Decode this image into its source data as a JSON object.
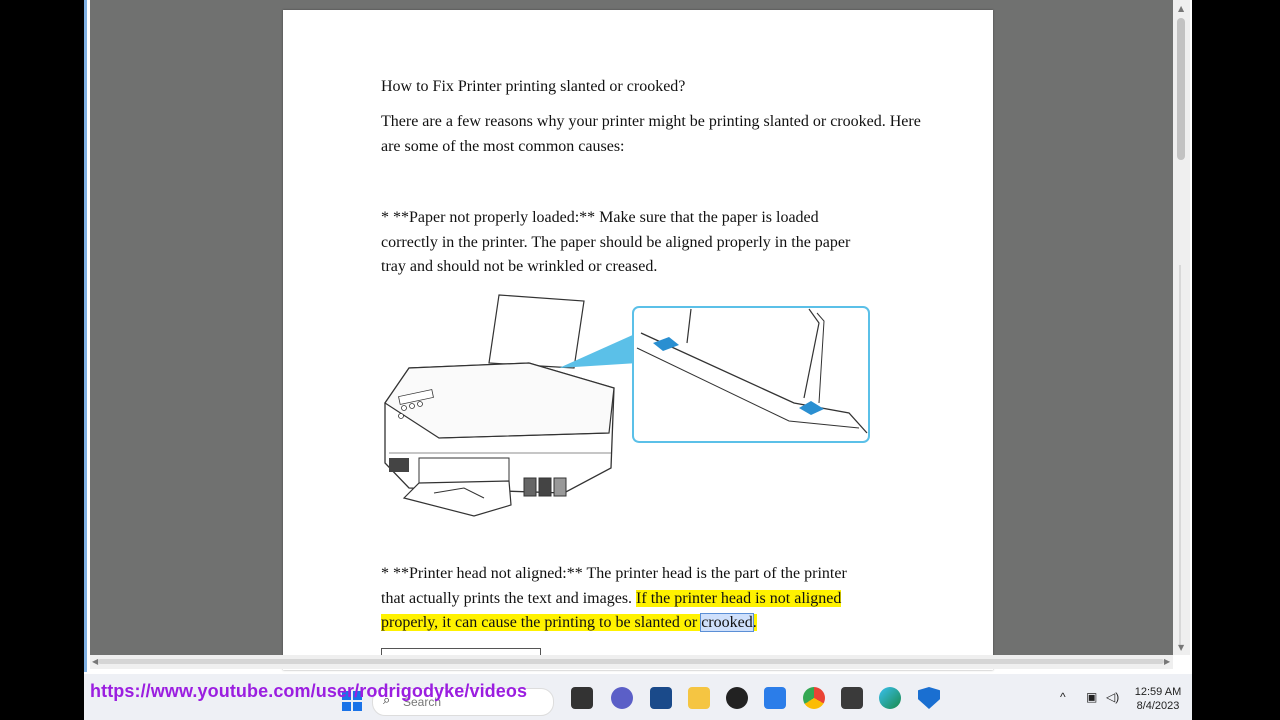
{
  "document": {
    "title": "How to Fix Printer printing slanted or crooked?",
    "intro": "There are a few reasons why your printer might be printing slanted or crooked. Here are some of the most common causes:",
    "cause1_l1": "* **Paper not properly loaded:** Make sure that the paper is loaded",
    "cause1_l2": "correctly in the printer. The paper should be aligned properly in the paper",
    "cause1_l3": "tray and should not be wrinkled or creased.",
    "cause2_l1": "* **Printer head not aligned:** The printer head is the part of the printer",
    "cause2_l2_plain": "that actually prints the text and images. ",
    "cause2_l2_hl": "If the printer head is not aligned",
    "cause2_l3_hl": "properly, it can cause the printing to be slanted or ",
    "cause2_l3_sel": "crooked",
    "cause2_l3_end": "."
  },
  "overlay": {
    "url": "https://www.youtube.com/user/rodrigodyke/videos"
  },
  "taskbar": {
    "search_placeholder": "Search",
    "time": "12:59 AM",
    "date": "8/4/2023"
  },
  "colors": {
    "highlight": "#fff200",
    "url": "#9b1ee0",
    "accent": "#5bc0e8"
  }
}
